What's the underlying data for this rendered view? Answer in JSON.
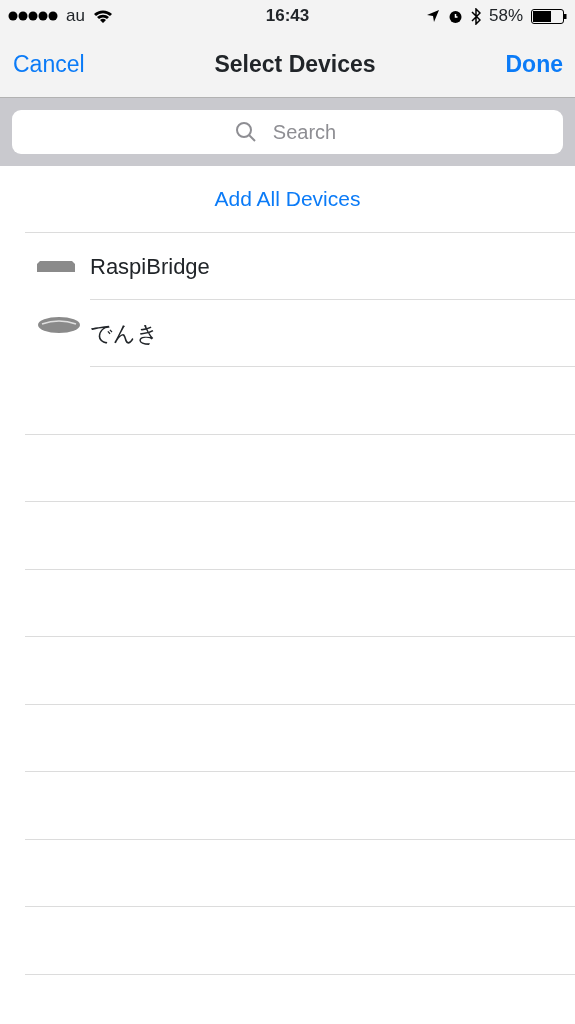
{
  "status_bar": {
    "carrier": "au",
    "time": "16:43",
    "battery": "58%"
  },
  "nav": {
    "cancel": "Cancel",
    "title": "Select Devices",
    "done": "Done"
  },
  "search": {
    "placeholder": "Search"
  },
  "add_all": "Add All Devices",
  "devices": [
    {
      "kind": "bridge",
      "name": "RaspiBridge"
    },
    {
      "kind": "light",
      "name": "でんき"
    }
  ]
}
